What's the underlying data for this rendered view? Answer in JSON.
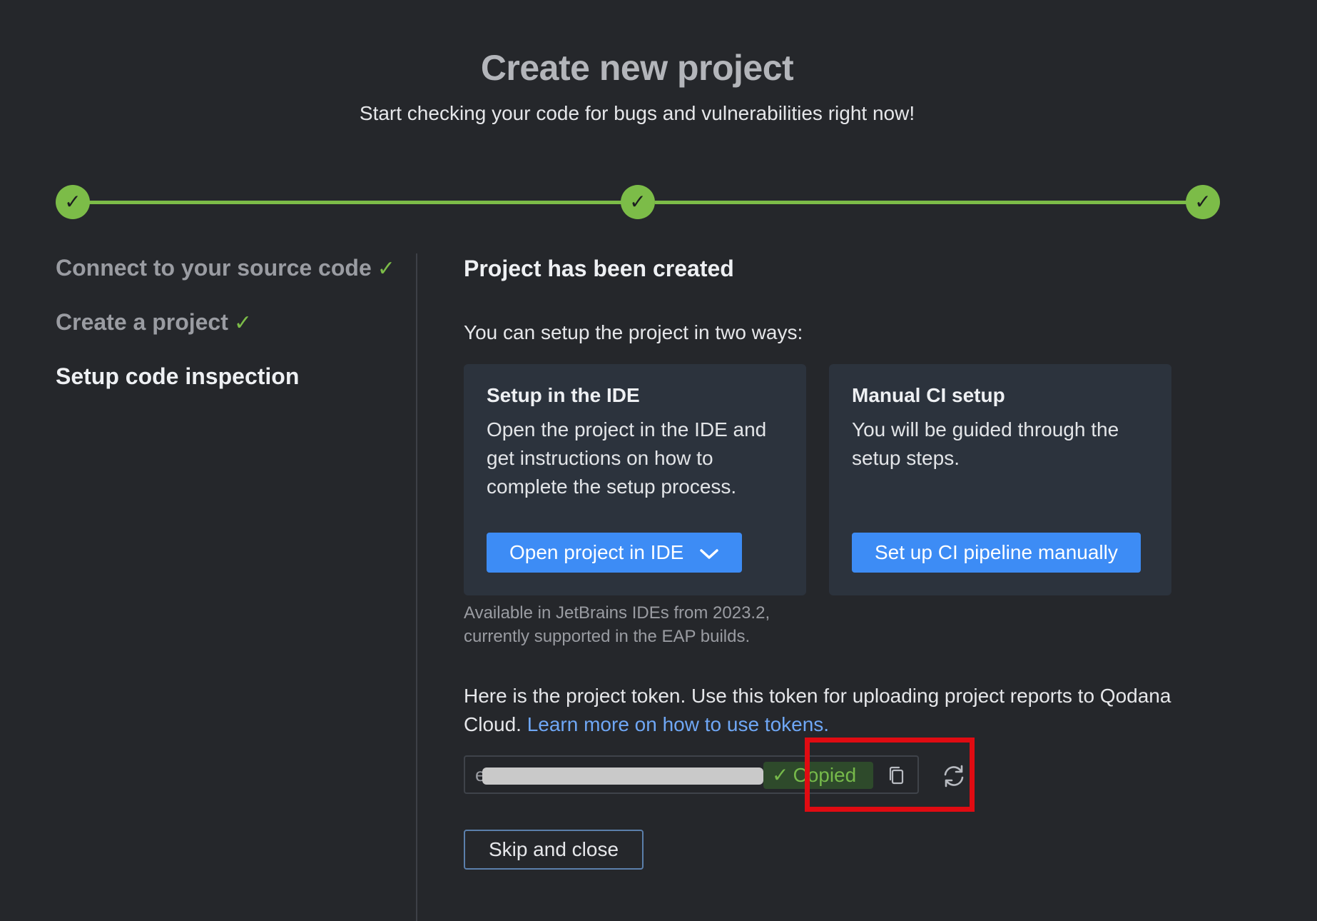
{
  "header": {
    "title": "Create new project",
    "subtitle": "Start checking your code for bugs and vulnerabilities right now!"
  },
  "stepper": {
    "completed_steps": 3,
    "total_steps": 3,
    "accent_color": "#7cbc48"
  },
  "nav": {
    "items": [
      {
        "label": "Connect to your source code",
        "status": "done",
        "check": "✓"
      },
      {
        "label": "Create a project",
        "status": "done",
        "check": "✓"
      },
      {
        "label": "Setup code inspection",
        "status": "active"
      }
    ]
  },
  "main": {
    "heading": "Project has been created",
    "intro": "You can setup the project in two ways:",
    "ide_card": {
      "title": "Setup in the IDE",
      "text": "Open the project in the IDE and get instructions on how to complete the setup process.",
      "button_label": "Open project in IDE"
    },
    "ci_card": {
      "title": "Manual CI setup",
      "text": "You will be guided through the setup steps.",
      "button_label": "Set up CI pipeline manually"
    },
    "note_line1": "Available in JetBrains IDEs from 2023.2,",
    "note_line2": "currently supported in the EAP builds.",
    "token_text": "Here is the project token. Use this token for uploading project reports to Qodana Cloud.",
    "token_link": "Learn more on how to use tokens.",
    "token": {
      "prefix": "e",
      "copied_label": "Copied",
      "copied_check": "✓"
    },
    "skip_label": "Skip and close"
  },
  "colors": {
    "primary_button": "#3d8cf5",
    "link": "#6fa7f5",
    "highlight": "#e00b12"
  }
}
